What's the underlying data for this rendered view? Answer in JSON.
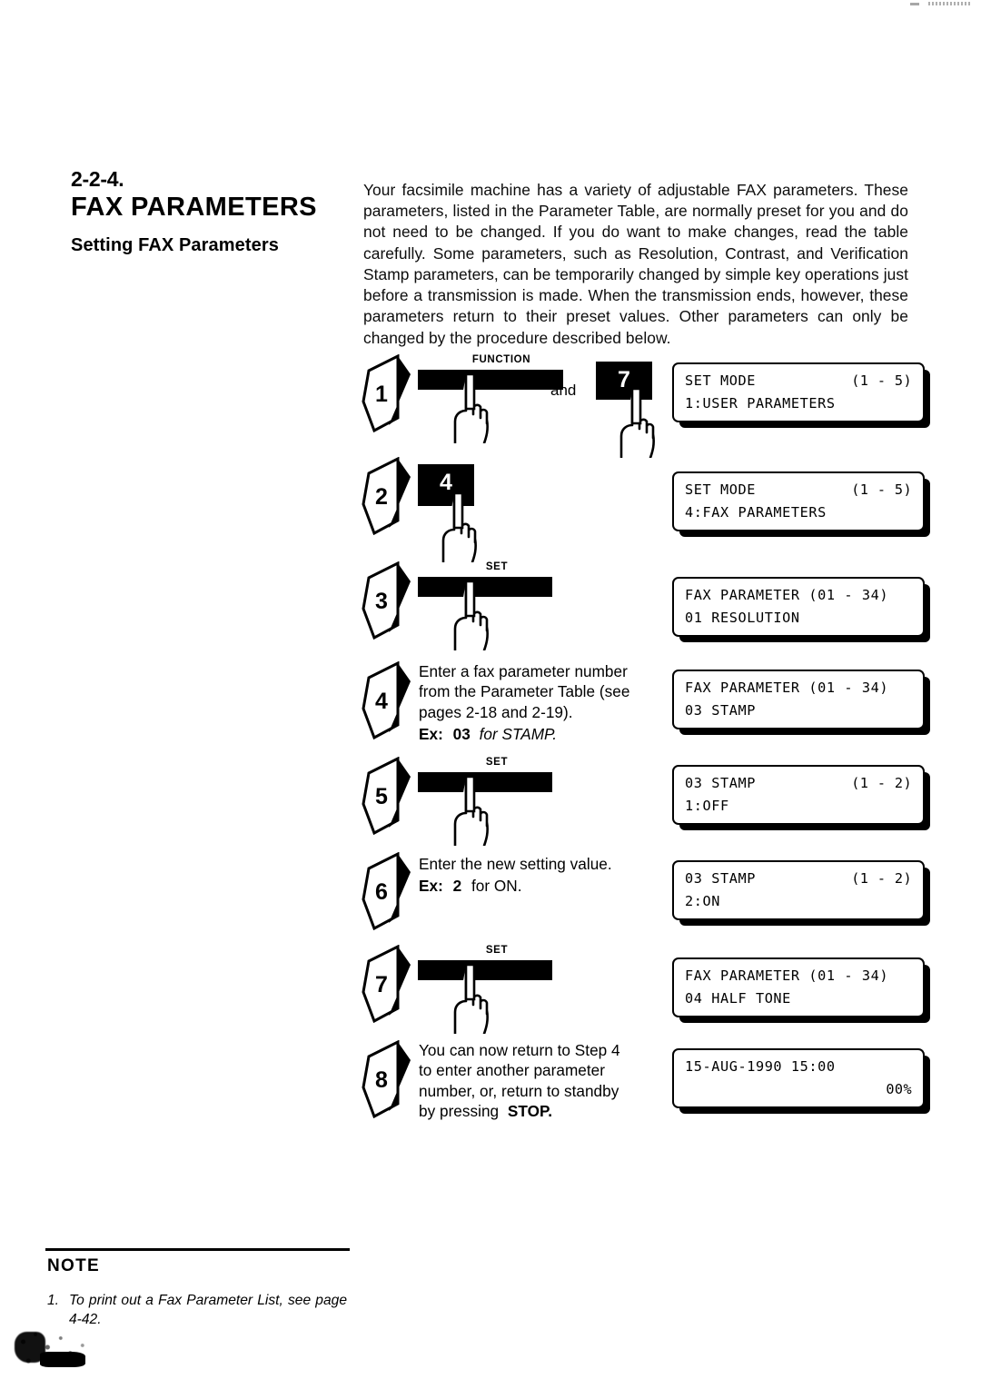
{
  "heading": {
    "section_number": "2-2-4.",
    "title": "FAX PARAMETERS",
    "subtitle": "Setting FAX Parameters"
  },
  "intro": {
    "paragraph": "Your facsimile machine has a variety of adjustable FAX parameters. These parameters, listed in the Parameter Table, are normally preset for you and do not need to be changed. If you do want to make changes, read the table carefully. Some parameters, such as Resolution, Contrast, and Verification Stamp parameters, can be temporarily changed by simple key operations just before a transmission is made. When the transmission ends, however, these parameters return to their preset values. Other parameters can only be changed by the procedure described below."
  },
  "conjunction": "and",
  "steps": [
    {
      "number": "1",
      "key_label": "FUNCTION",
      "key_type": "bar",
      "second_key": "7",
      "second_key_type": "square",
      "lcd": {
        "line1_left": "SET MODE",
        "line1_right": "(1 - 5)",
        "line2_left": "1:USER PARAMETERS",
        "line2_right": ""
      }
    },
    {
      "number": "2",
      "key_label": "",
      "key_type": "square",
      "key_glyph": "4",
      "lcd": {
        "line1_left": "SET MODE",
        "line1_right": "(1 - 5)",
        "line2_left": "4:FAX PARAMETERS",
        "line2_right": ""
      }
    },
    {
      "number": "3",
      "key_label": "SET",
      "key_type": "bar",
      "lcd": {
        "line1_left": "FAX PARAMETER (01 - 34)",
        "line1_right": "",
        "line2_left": "01 RESOLUTION",
        "line2_right": ""
      }
    },
    {
      "number": "4",
      "instruction_line1": "Enter a fax parameter number",
      "instruction_line2": "from the Parameter Table (see",
      "instruction_line3": "pages 2-18 and 2-19).",
      "example_label": "Ex:",
      "example_value": "03",
      "example_tail": "for STAMP.",
      "lcd": {
        "line1_left": "FAX PARAMETER  (01 - 34)",
        "line1_right": "",
        "line2_left": "03 STAMP",
        "line2_right": ""
      }
    },
    {
      "number": "5",
      "key_label": "SET",
      "key_type": "bar",
      "lcd": {
        "line1_left": "03 STAMP",
        "line1_right": "(1 - 2)",
        "line2_left": "1:OFF",
        "line2_right": ""
      }
    },
    {
      "number": "6",
      "instruction_line1": "Enter the new setting value.",
      "example_label": "Ex:",
      "example_value": "2",
      "example_tail": "for ON.",
      "lcd": {
        "line1_left": "03 STAMP",
        "line1_right": "(1 - 2)",
        "line2_left": "2:ON",
        "line2_right": ""
      }
    },
    {
      "number": "7",
      "key_label": "SET",
      "key_type": "bar",
      "lcd": {
        "line1_left": "FAX PARAMETER (01 - 34)",
        "line1_right": "",
        "line2_left": "04 HALF TONE",
        "line2_right": ""
      }
    },
    {
      "number": "8",
      "instruction_line1": "You can now return to Step 4",
      "instruction_line2": "to enter another parameter",
      "instruction_line3": "number, or, return to standby",
      "instruction_line4": "by pressing",
      "instruction_bold": "STOP.",
      "lcd": {
        "line1_left": "15-AUG-1990  15:00",
        "line1_right": "",
        "line2_left": "",
        "line2_right": "00%"
      }
    }
  ],
  "note": {
    "heading": "NOTE",
    "item_number": "1.",
    "item_text": "To print out a Fax Parameter List, see page 4-42."
  }
}
